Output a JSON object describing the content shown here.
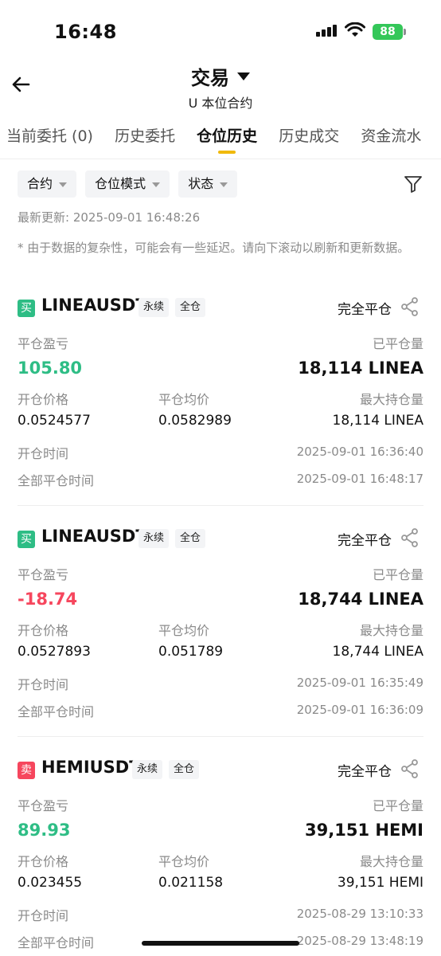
{
  "status_bar": {
    "time": "16:48",
    "battery": "88"
  },
  "header": {
    "title": "交易",
    "subtitle": "U 本位合约"
  },
  "tabs": [
    {
      "label": "当前委托 (0)"
    },
    {
      "label": "历史委托"
    },
    {
      "label": "仓位历史",
      "active": true
    },
    {
      "label": "历史成交"
    },
    {
      "label": "资金流水"
    },
    {
      "label": "资"
    }
  ],
  "filters": {
    "contract": "合约",
    "position_mode": "仓位模式",
    "status": "状态"
  },
  "last_updated": "最新更新: 2025-09-01 16:48:26",
  "note": "* 由于数据的复杂性，可能会有一些延迟。请向下滚动以刷新和更新数据。",
  "labels": {
    "realized_pnl": "平仓盈亏",
    "closed_qty": "已平仓量",
    "open_price": "开仓价格",
    "avg_close_price": "平仓均价",
    "max_position": "最大持仓量",
    "open_time": "开仓时间",
    "full_close_time": "全部平仓时间"
  },
  "positions": [
    {
      "side": "买",
      "side_type": "buy",
      "symbol": "LINEAUSDT",
      "contract_type": "永续",
      "margin_mode": "全仓",
      "close_type": "完全平仓",
      "realized_pnl": "105.80",
      "pnl_sign": "pos",
      "closed_qty": "18,114 LINEA",
      "open_price": "0.0524577",
      "avg_close_price": "0.0582989",
      "max_position": "18,114 LINEA",
      "open_time": "2025-09-01 16:36:40",
      "full_close_time": "2025-09-01 16:48:17"
    },
    {
      "side": "买",
      "side_type": "buy",
      "symbol": "LINEAUSDT",
      "contract_type": "永续",
      "margin_mode": "全仓",
      "close_type": "完全平仓",
      "realized_pnl": "-18.74",
      "pnl_sign": "neg",
      "closed_qty": "18,744 LINEA",
      "open_price": "0.0527893",
      "avg_close_price": "0.051789",
      "max_position": "18,744 LINEA",
      "open_time": "2025-09-01 16:35:49",
      "full_close_time": "2025-09-01 16:36:09"
    },
    {
      "side": "卖",
      "side_type": "sell",
      "symbol": "HEMIUSDT",
      "contract_type": "永续",
      "margin_mode": "全仓",
      "close_type": "完全平仓",
      "realized_pnl": "89.93",
      "pnl_sign": "pos",
      "closed_qty": "39,151 HEMI",
      "open_price": "0.023455",
      "avg_close_price": "0.021158",
      "max_position": "39,151 HEMI",
      "open_time": "2025-08-29 13:10:33",
      "full_close_time": "2025-08-29 13:48:19"
    }
  ],
  "colors": {
    "accent": "#f0b90b",
    "profit": "#2ebd85",
    "loss": "#f6465d",
    "muted": "#8a8a8a"
  },
  "icons": [
    "back-arrow-icon",
    "caret-down-icon",
    "filter-funnel-icon",
    "share-icon",
    "signal-icon",
    "wifi-icon",
    "battery-icon"
  ]
}
